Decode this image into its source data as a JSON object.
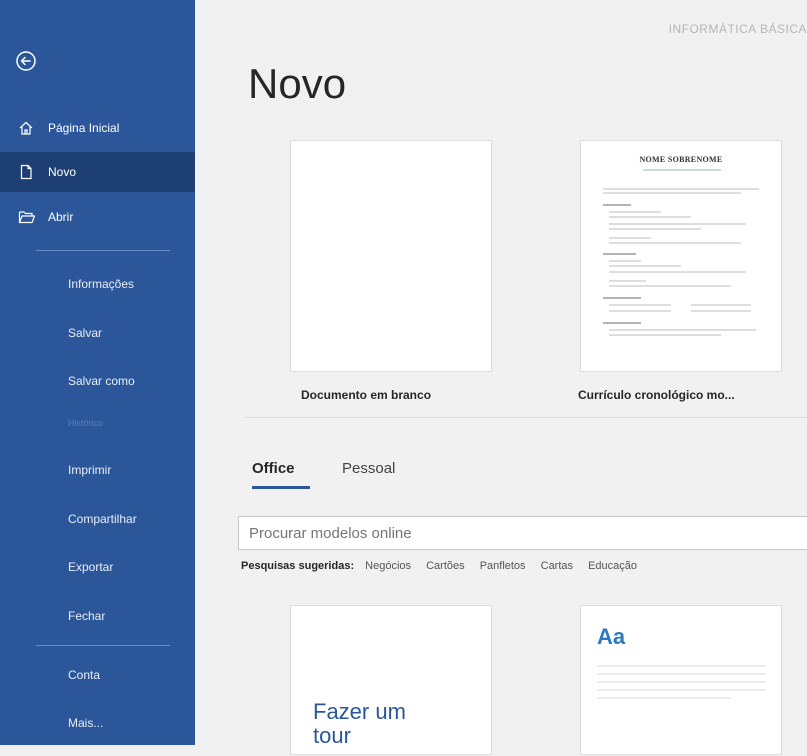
{
  "sidebar": {
    "back_label": "Voltar",
    "items": [
      {
        "label": "Página Inicial",
        "icon": "home-icon"
      },
      {
        "label": "Novo",
        "icon": "new-document-icon"
      },
      {
        "label": "Abrir",
        "icon": "open-folder-icon"
      }
    ],
    "sub_items": [
      {
        "label": "Informações"
      },
      {
        "label": "Salvar"
      },
      {
        "label": "Salvar como"
      },
      {
        "label": "Histórico"
      },
      {
        "label": "Imprimir"
      },
      {
        "label": "Compartilhar"
      },
      {
        "label": "Exportar"
      },
      {
        "label": "Fechar"
      }
    ],
    "bottom_items": [
      {
        "label": "Conta"
      },
      {
        "label": "Mais..."
      }
    ]
  },
  "header": {
    "document_title": "INFORMÁTICA BÁSICA",
    "page_title": "Novo"
  },
  "templates": [
    {
      "label": "Documento em branco"
    },
    {
      "label": "Currículo cronológico mo...",
      "preview_name": "NOME SOBRENOME"
    }
  ],
  "tabs": [
    {
      "label": "Office"
    },
    {
      "label": "Pessoal"
    }
  ],
  "search": {
    "placeholder": "Procurar modelos online"
  },
  "suggested": {
    "label": "Pesquisas sugeridas:",
    "links": [
      "Negócios",
      "Cartões",
      "Panfletos",
      "Cartas",
      "Educação"
    ]
  },
  "lower_templates": [
    {
      "text_line1": "Fazer um",
      "text_line2": "tour"
    },
    {
      "preview": "Aa"
    }
  ],
  "colors": {
    "sidebar": "#2b579a",
    "sidebar_active": "#1e3f73",
    "accent": "#2b579a"
  }
}
